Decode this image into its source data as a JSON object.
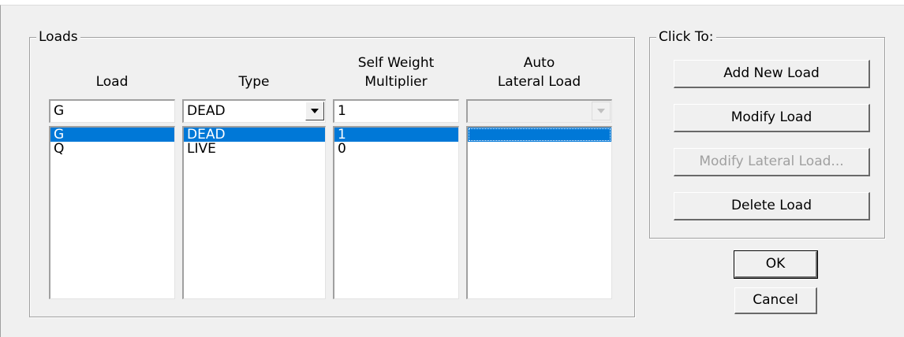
{
  "loads_group": {
    "title": "Loads",
    "headers": {
      "load": "Load",
      "type": "Type",
      "self_weight": "Self Weight\nMultiplier",
      "auto_lateral": "Auto\nLateral Load"
    },
    "inputs": {
      "load_name": "G",
      "type": "DEAD",
      "self_weight": "1",
      "auto_lateral": ""
    },
    "rows": [
      {
        "load": "G",
        "type": "DEAD",
        "self_weight": "1",
        "auto_lateral": "",
        "selected": true
      },
      {
        "load": "Q",
        "type": "LIVE",
        "self_weight": "0",
        "auto_lateral": "",
        "selected": false
      }
    ]
  },
  "actions_group": {
    "title": "Click To:",
    "add_new_load": "Add New Load",
    "modify_load": "Modify Load",
    "modify_lateral_load": "Modify Lateral Load...",
    "delete_load": "Delete Load"
  },
  "dialog_buttons": {
    "ok": "OK",
    "cancel": "Cancel"
  },
  "colors": {
    "selection": "#0078d7",
    "dialog_bg": "#f0f0f0",
    "disabled_text": "#a0a0a0"
  }
}
